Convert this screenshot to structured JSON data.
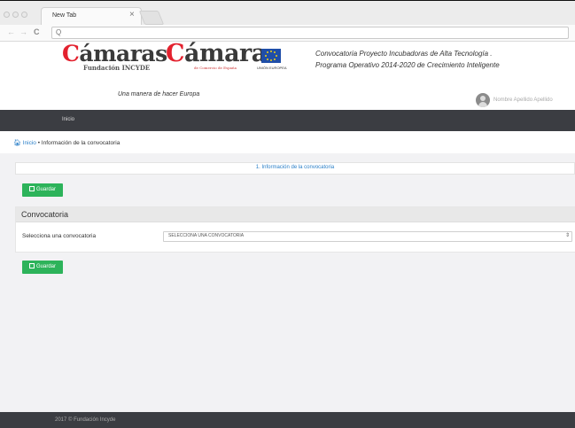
{
  "browser": {
    "tab_title": "New Tab",
    "tab_close": "×",
    "nav_back": "←",
    "nav_forward": "→",
    "nav_reload": "C",
    "url_icon": "Q",
    "url_value": ""
  },
  "header": {
    "logo1_main_a": "C",
    "logo1_main_b": "ámaras",
    "logo1_sub": "Fundación INCYDE",
    "logo2_main_a": "C",
    "logo2_main_b": "ámara",
    "logo2_sub": "de Comercio de España",
    "eu_label": "UNIÓN EUROPEA",
    "tagline": "Una manera de hacer Europa",
    "promo_line1": "Convocatoria Proyecto Incubadoras de Alta Tecnología .",
    "promo_line2": "Programa Operativo 2014-2020 de Crecimiento Inteligente",
    "user_name": "Nombre Apellido Apellido"
  },
  "nav": {
    "home_label": "Inicio"
  },
  "breadcrumb": {
    "home_icon": "🏠︎",
    "home_label": "Inicio",
    "separator": "•",
    "current": "Información de la convocatoria"
  },
  "steps": {
    "step1_label": "1. Información de la convocatoria"
  },
  "form": {
    "save_label": "Guardar",
    "panel_title": "Convocatoria",
    "field_label": "Selecciona una convocatoria",
    "select_value": "SELECCIONA UNA CONVOCATORIA",
    "select_arrow": "⇕"
  },
  "footer": {
    "text": "2017 © Fundación Incyde"
  },
  "colors": {
    "accent_green": "#2db35a",
    "link_blue": "#2a7fc8",
    "navbar": "#3b3d42",
    "brand_red": "#e3212e",
    "eu_blue": "#1f4ea8"
  }
}
